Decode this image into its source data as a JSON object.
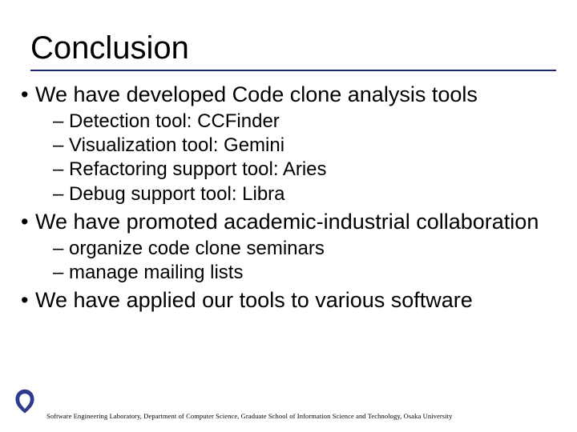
{
  "title": "Conclusion",
  "bullets": {
    "b1": {
      "text": "We have developed Code clone analysis tools",
      "sub": {
        "s1": "Detection tool: CCFinder",
        "s2": "Visualization tool: Gemini",
        "s3": "Refactoring support tool: Aries",
        "s4": "Debug support tool: Libra"
      }
    },
    "b2": {
      "text": "We have promoted academic-industrial collaboration",
      "sub": {
        "s1": "organize code clone seminars",
        "s2": "manage mailing lists"
      }
    },
    "b3": {
      "text": "We have applied our tools to various software"
    }
  },
  "footer": "Software Engineering Laboratory, Department of Computer Science, Graduate School of Information Science and Technology, Osaka University",
  "colors": {
    "accent": "#1a237e",
    "logo": "#2e3a8c"
  }
}
